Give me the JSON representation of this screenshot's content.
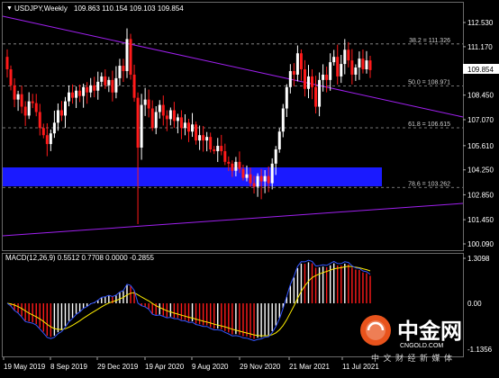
{
  "chart_header": {
    "title": "USDJPY,Weekly",
    "ohlc": "109.863 110.154 109.103 109.854"
  },
  "macd": {
    "label": "MACD(12,26,9) 0.5512 0.7708 0.0000 -0.2855",
    "scale_top": "1.3098",
    "scale_zero": "0.00",
    "scale_bottom": "-1.1356"
  },
  "current_price": "109.854",
  "price_ticks": [
    "112.530",
    "111.170",
    "109.854",
    "108.450",
    "107.070",
    "105.610",
    "104.250",
    "102.850",
    "101.450",
    "100.090"
  ],
  "fib_levels": [
    {
      "label": "38.2 = 111.326",
      "price": 111.326
    },
    {
      "label": "50.0 = 108.971",
      "price": 108.971
    },
    {
      "label": "61.8 = 106.615",
      "price": 106.615
    },
    {
      "label": "78.6 = 103.262",
      "price": 103.262
    }
  ],
  "date_ticks": [
    "19 May 2019",
    "8 Sep 2019",
    "29 Dec 2019",
    "19 Apr 2020",
    "9 Aug 2020",
    "29 Nov 2020",
    "21 Mar 2021",
    "11 Jul 2021"
  ],
  "watermark": {
    "logo_text": "中金网",
    "site": "CNGOLD.COM",
    "slogan": "中 文 财 经 新 媒 体"
  },
  "colors": {
    "background": "#000000",
    "candle_up": "#ffffff",
    "candle_down": "#ff1a1a",
    "trendline": "#a020f0",
    "zone": "#1a1aff",
    "macd_signal": "#ffee00",
    "macd_line": "#3355ff",
    "logo": "#e8531c"
  },
  "chart_data": {
    "type": "candlestick",
    "timeframe": "Weekly",
    "symbol": "USDJPY",
    "ylim": [
      100.09,
      113.2
    ],
    "closes": [
      109.9,
      109.0,
      108.2,
      108.5,
      107.8,
      107.3,
      108.1,
      108.0,
      107.5,
      106.6,
      106.2,
      105.7,
      106.3,
      106.9,
      107.6,
      107.3,
      108.1,
      108.6,
      108.3,
      108.7,
      108.4,
      108.9,
      108.6,
      109.0,
      108.7,
      109.2,
      109.5,
      109.0,
      109.3,
      108.6,
      109.4,
      110.1,
      109.8,
      111.6,
      109.6,
      108.3,
      105.5,
      107.9,
      108.2,
      107.7,
      106.6,
      107.5,
      107.9,
      107.3,
      107.1,
      107.6,
      107.0,
      107.2,
      106.6,
      106.9,
      106.4,
      106.8,
      105.9,
      106.2,
      105.9,
      106.1,
      105.4,
      105.3,
      105.6,
      105.3,
      104.7,
      104.6,
      104.2,
      104.7,
      104.3,
      103.8,
      104.0,
      103.5,
      103.3,
      103.9,
      103.6,
      103.9,
      103.5,
      104.6,
      105.4,
      106.4,
      107.7,
      108.9,
      109.8,
      109.6,
      110.8,
      109.9,
      108.8,
      109.5,
      108.9,
      107.8,
      109.3,
      109.6,
      109.3,
      110.3,
      110.6,
      109.5,
      110.2,
      111.0,
      110.4,
      109.6,
      110.0,
      110.5,
      109.9,
      110.4,
      109.854
    ],
    "fib_levels": [
      111.326,
      108.971,
      106.615,
      103.262
    ],
    "zone": [
      103.2,
      104.4
    ],
    "macd": {
      "params": "12,26,9",
      "main": 0.5512,
      "signal": 0.7708,
      "ylim": [
        -1.1356,
        1.3098
      ]
    }
  }
}
